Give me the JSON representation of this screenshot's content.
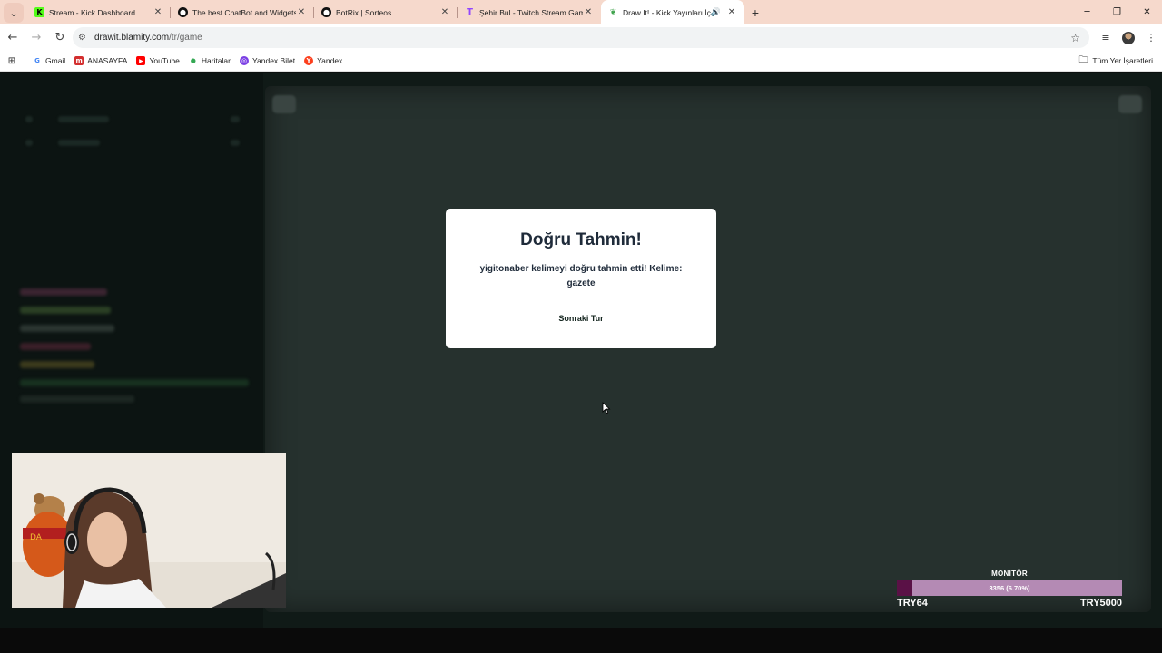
{
  "browser": {
    "tabs": [
      {
        "title": "Stream - Kick Dashboard",
        "favicon": "kick-icon",
        "color": "#53fc18",
        "active": false
      },
      {
        "title": "The best ChatBot and Widgets",
        "favicon": "github-icon",
        "color": "#111111",
        "active": false
      },
      {
        "title": "BotRix | Sorteos",
        "favicon": "github-icon",
        "color": "#111111",
        "active": false
      },
      {
        "title": "Şehir Bul - Twitch Stream Game",
        "favicon": "twitch-t-icon",
        "color": "#9146ff",
        "active": false
      },
      {
        "title": "Draw It! - Kick Yayınları İçin",
        "favicon": "leaf-icon",
        "color": "#3fa34d",
        "active": true
      }
    ],
    "url_host": "drawit.blamity.com",
    "url_path": "/tr/game",
    "bookmarks": [
      {
        "label": "Gmail",
        "icon": "google-icon",
        "color": "#4285f4"
      },
      {
        "label": "ANASAYFA",
        "icon": "m-icon",
        "color": "#d32f2f"
      },
      {
        "label": "YouTube",
        "icon": "youtube-icon",
        "color": "#ff0000"
      },
      {
        "label": "Haritalar",
        "icon": "maps-pin-icon",
        "color": "#34a853"
      },
      {
        "label": "Yandex.Bilet",
        "icon": "yandex-bilet-icon",
        "color": "#7b3fe4"
      },
      {
        "label": "Yandex",
        "icon": "yandex-icon",
        "color": "#fc3f1d"
      }
    ],
    "all_bookmarks_label": "Tüm Yer İşaretleri"
  },
  "modal": {
    "title": "Doğru Tahmin!",
    "message": "yigitonaber kelimeyi doğru tahmin etti! Kelime: gazete",
    "button_label": "Sonraki Tur"
  },
  "goal": {
    "title": "MONİTÖR",
    "bar_text": "3356 (6.70%)",
    "progress": 0.067,
    "start_label": "TRY64",
    "end_label": "TRY5000",
    "fill_color": "#5a1146",
    "track_color": "#b48ab4"
  }
}
